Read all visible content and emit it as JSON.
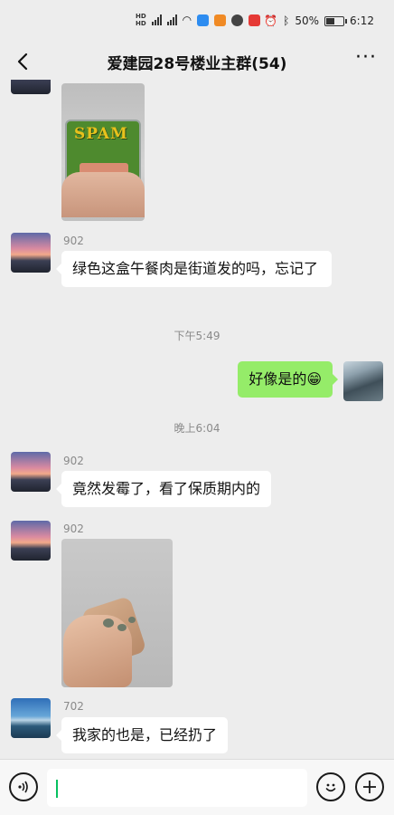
{
  "status_bar": {
    "battery": "50%",
    "time": "6:12",
    "battery_level": 0.5
  },
  "header": {
    "title": "爱建园28号楼业主群(54)",
    "back_icon": "chevron-left-icon",
    "more_icon": "more-dots-icon",
    "more_label": "···"
  },
  "messages": [
    {
      "type": "image",
      "side": "left",
      "content": "spam-can-photo",
      "can_label": "SPAM"
    },
    {
      "type": "text",
      "side": "left",
      "sender": "902",
      "text": "绿色这盒午餐肉是街道发的吗，忘记了"
    },
    {
      "type": "timestamp",
      "text": "下午5:49"
    },
    {
      "type": "text",
      "side": "right",
      "text": "好像是的😁"
    },
    {
      "type": "timestamp",
      "text": "晚上6:04"
    },
    {
      "type": "text",
      "side": "left",
      "sender": "902",
      "text": "竟然发霉了，看了保质期内的"
    },
    {
      "type": "image",
      "side": "left",
      "sender": "902",
      "content": "moldy-spam-photo"
    },
    {
      "type": "text",
      "side": "left",
      "sender": "702",
      "text": "我家的也是，已经扔了"
    }
  ],
  "input_bar": {
    "voice_icon": "voice-icon",
    "emoji_icon": "emoji-icon",
    "add_icon": "plus-icon",
    "placeholder": ""
  },
  "colors": {
    "background": "#ededed",
    "bubble_self": "#95ec69",
    "bubble_other": "#ffffff",
    "caret": "#07c160"
  }
}
